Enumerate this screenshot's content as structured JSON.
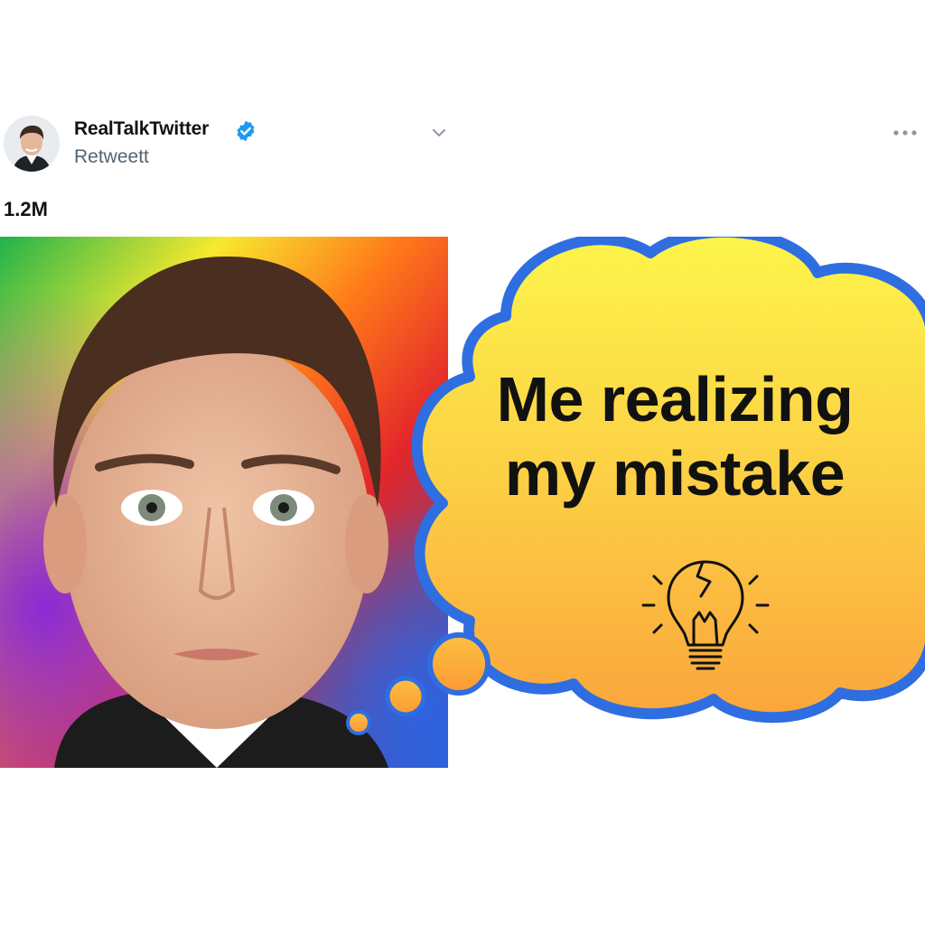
{
  "tweet": {
    "author": {
      "name": "RealTalkTwitter",
      "subtitle": "Retweett",
      "verified": true,
      "verified_icon": "verified-badge-icon",
      "avatar_icon": "avatar-photo"
    },
    "count": "1.2M",
    "menu_icons": [
      "chevron-down-icon",
      "more-icon"
    ]
  },
  "meme": {
    "caption_line1": "Me realizing",
    "caption_line2": "my mistake",
    "bubble_icon": "broken-lightbulb-icon",
    "colors": {
      "bubble_top": "#fdf54a",
      "bubble_bottom": "#fba53c",
      "bubble_outline": "#2f6ee0",
      "verified_blue": "#1d9bf0"
    }
  }
}
